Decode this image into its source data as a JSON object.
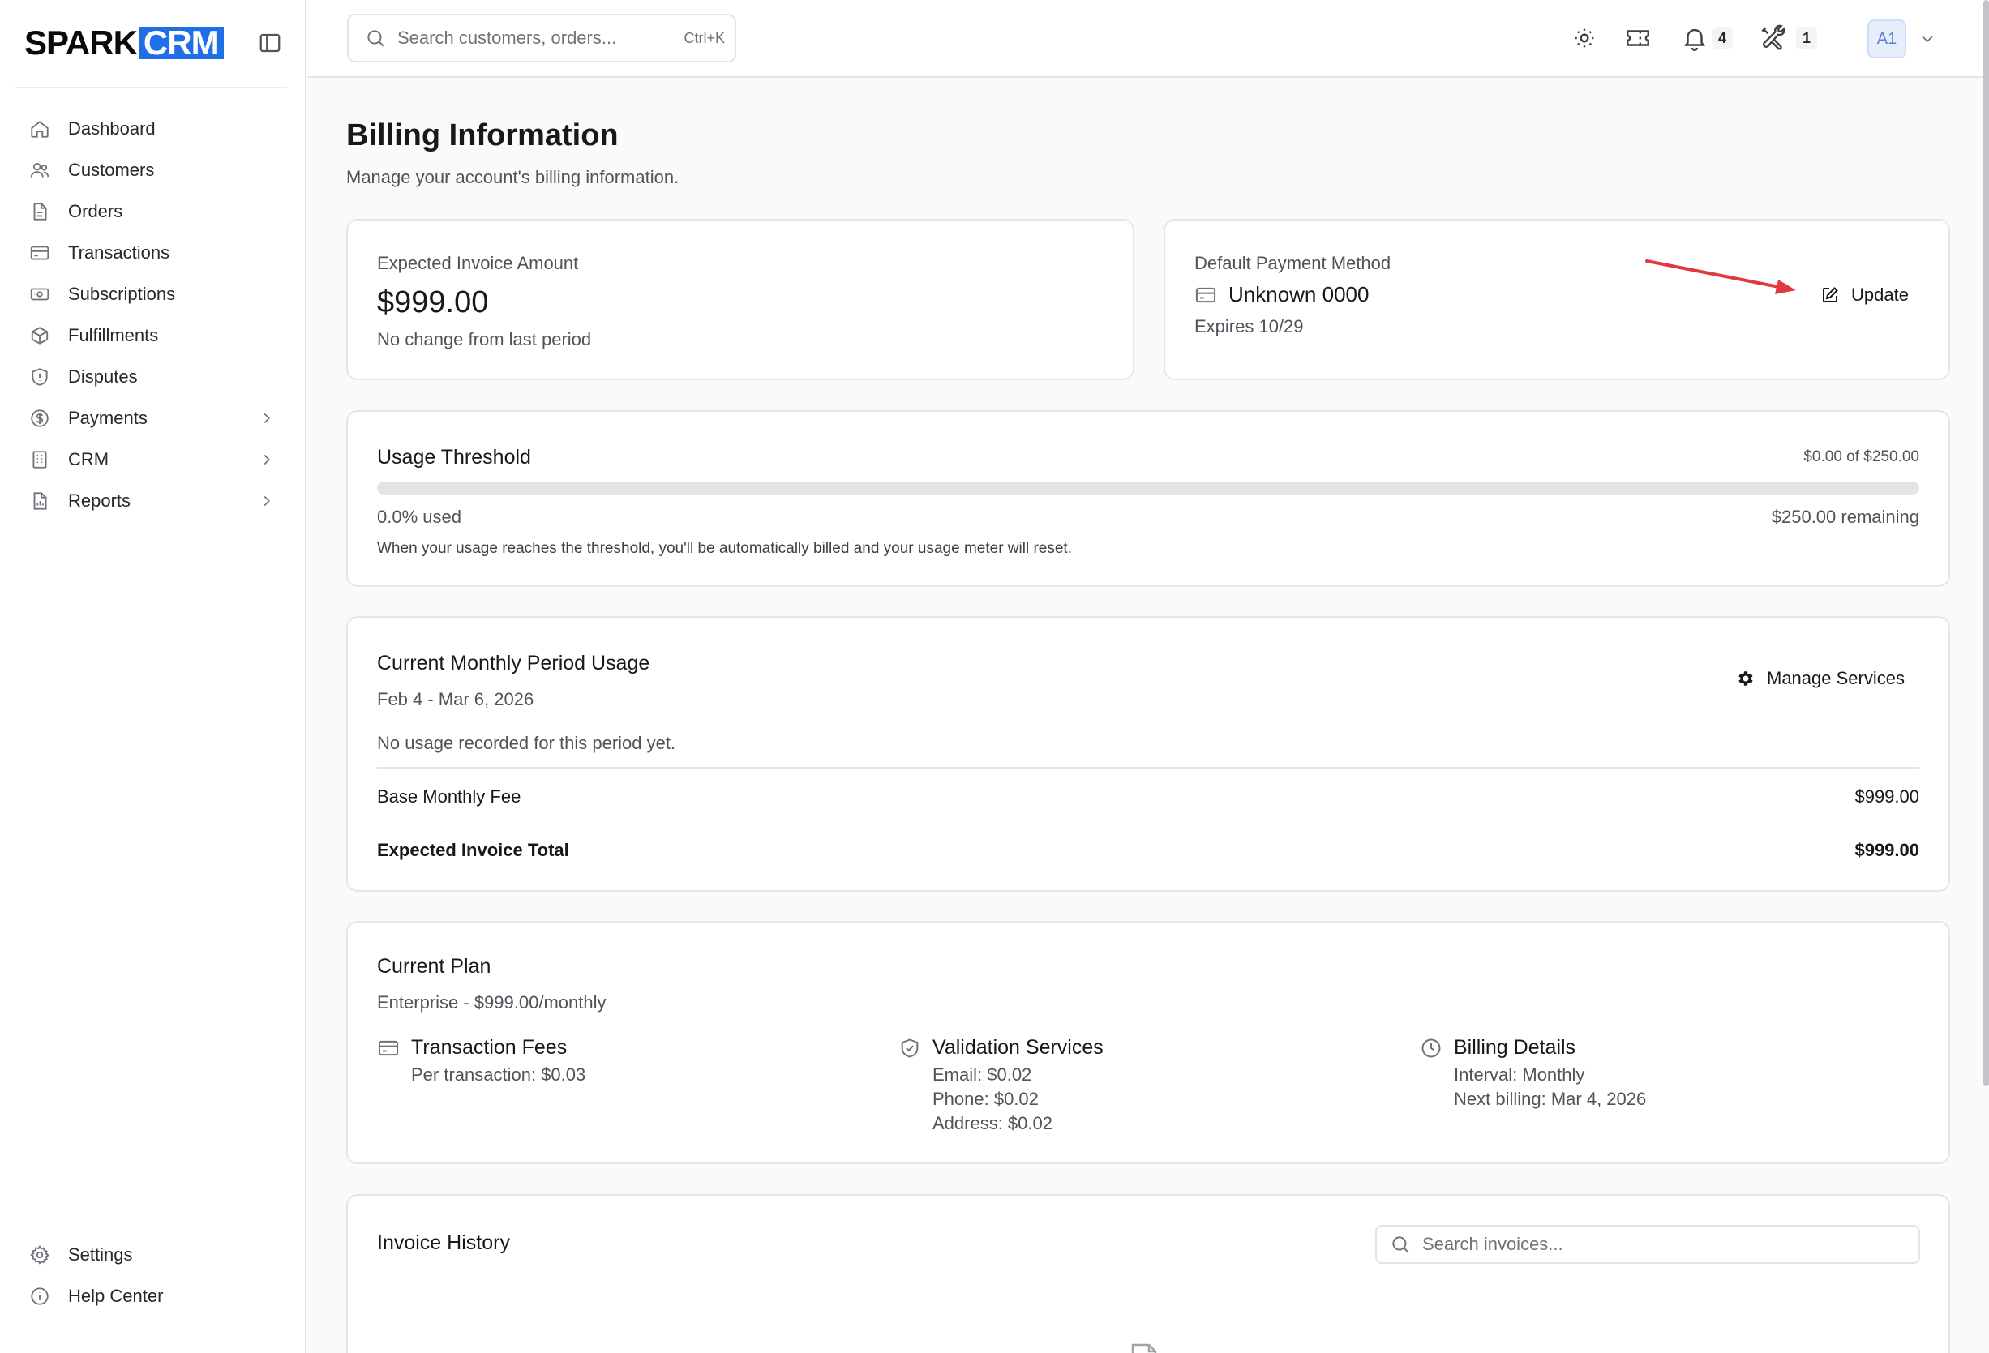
{
  "brand": {
    "part1": "SPARK",
    "part2": "CRM"
  },
  "sidebar": {
    "items": [
      {
        "label": "Dashboard"
      },
      {
        "label": "Customers"
      },
      {
        "label": "Orders"
      },
      {
        "label": "Transactions"
      },
      {
        "label": "Subscriptions"
      },
      {
        "label": "Fulfillments"
      },
      {
        "label": "Disputes"
      },
      {
        "label": "Payments"
      },
      {
        "label": "CRM"
      },
      {
        "label": "Reports"
      }
    ],
    "bottom": [
      {
        "label": "Settings"
      },
      {
        "label": "Help Center"
      }
    ]
  },
  "topbar": {
    "search_placeholder": "Search customers, orders...",
    "search_shortcut": "Ctrl+K",
    "notifications_count": "4",
    "tools_count": "1",
    "avatar": "A1"
  },
  "page": {
    "title": "Billing Information",
    "subtitle": "Manage your account's billing information."
  },
  "invoice_amount": {
    "label": "Expected Invoice Amount",
    "value": "$999.00",
    "note": "No change from last period"
  },
  "payment_method": {
    "label": "Default Payment Method",
    "card": "Unknown 0000",
    "expires": "Expires 10/29",
    "update_label": "Update",
    "annotation_arrow_color": "#e0393e"
  },
  "usage_threshold": {
    "title": "Usage Threshold",
    "summary": "$0.00 of $250.00",
    "used_fraction": 0.0,
    "used_label": "0.0% used",
    "remaining": "$250.00 remaining",
    "note": "When your usage reaches the threshold, you'll be automatically billed and your usage meter will reset."
  },
  "monthly_usage": {
    "title": "Current Monthly Period Usage",
    "period": "Feb 4 - Mar 6, 2026",
    "manage_label": "Manage Services",
    "empty_note": "No usage recorded for this period yet.",
    "base_fee_label": "Base Monthly Fee",
    "base_fee_value": "$999.00",
    "total_label": "Expected Invoice Total",
    "total_value": "$999.00"
  },
  "plan": {
    "title": "Current Plan",
    "subtitle": "Enterprise - $999.00/monthly",
    "features": [
      {
        "title": "Transaction Fees",
        "icon": "credit-card-icon",
        "lines": [
          "Per transaction: $0.03"
        ]
      },
      {
        "title": "Validation Services",
        "icon": "shield-check-icon",
        "lines": [
          "Email: $0.02",
          "Phone: $0.02",
          "Address: $0.02"
        ]
      },
      {
        "title": "Billing Details",
        "icon": "clock-icon",
        "lines": [
          "Interval: Monthly",
          "Next billing: Mar 4, 2026"
        ]
      }
    ]
  },
  "invoice_history": {
    "title": "Invoice History",
    "search_placeholder": "Search invoices..."
  },
  "colors": {
    "accent": "#1f6fe8",
    "annotation": "#e0393e",
    "border": "#e6e6e9"
  }
}
